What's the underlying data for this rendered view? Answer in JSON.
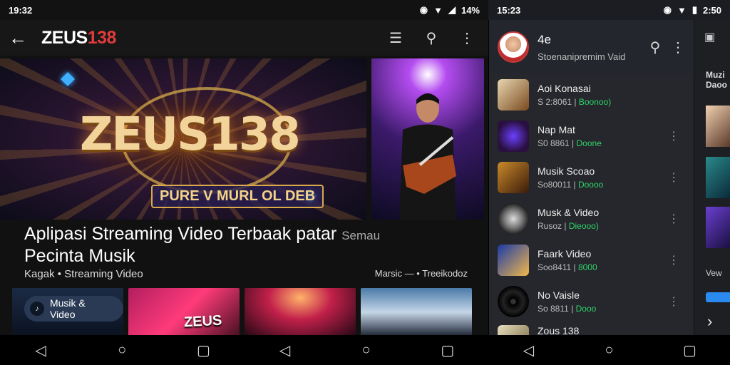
{
  "status_left": {
    "time": "19:32",
    "battery": "14%"
  },
  "status_right": {
    "time": "15:23",
    "battery": "2:50"
  },
  "appbar": {
    "back_icon": "arrow-left-icon",
    "logo_text": "ZEUS",
    "logo_num": "138"
  },
  "hero": {
    "title": "ZEUS138",
    "subtitle": "PURE V MURL OL DEB"
  },
  "video": {
    "title": "Aplipasi Streaming Video Terbaak patar",
    "title_tail": "Semau",
    "title_line2": "Pecinta Musik",
    "category": "Kagak • Streaming Video",
    "meta": "Marsic — • Treeikodoz"
  },
  "thumbs": {
    "chip_label": "Musik & Video",
    "thumb2_label": "ZEUS"
  },
  "drawer": {
    "user_name": "4e",
    "user_sub": "Stoenanipremim Vaid",
    "items": [
      {
        "title": "Aoi Konasai",
        "meta": "S 2:8061 |",
        "meta_green": "Boonoo)"
      },
      {
        "title": "Nap Mat",
        "meta": "S0 8861 |",
        "meta_green": "Doone"
      },
      {
        "title": "Musik Scoao",
        "meta": "So80011 |",
        "meta_green": "Doooo"
      },
      {
        "title": "Musk & Video",
        "meta": "Rusoz | ",
        "meta_green": "Dieooo)"
      },
      {
        "title": "Faark Video",
        "meta": "Soo8411 |",
        "meta_green": "8000"
      },
      {
        "title": "No Vaisle",
        "meta": "So 8811 |",
        "meta_green": "Dooo"
      },
      {
        "title": "Zous 138",
        "meta": "",
        "meta_green": ""
      }
    ]
  },
  "rightpane": {
    "text": "Muzi Daoo",
    "more": "Vew"
  }
}
